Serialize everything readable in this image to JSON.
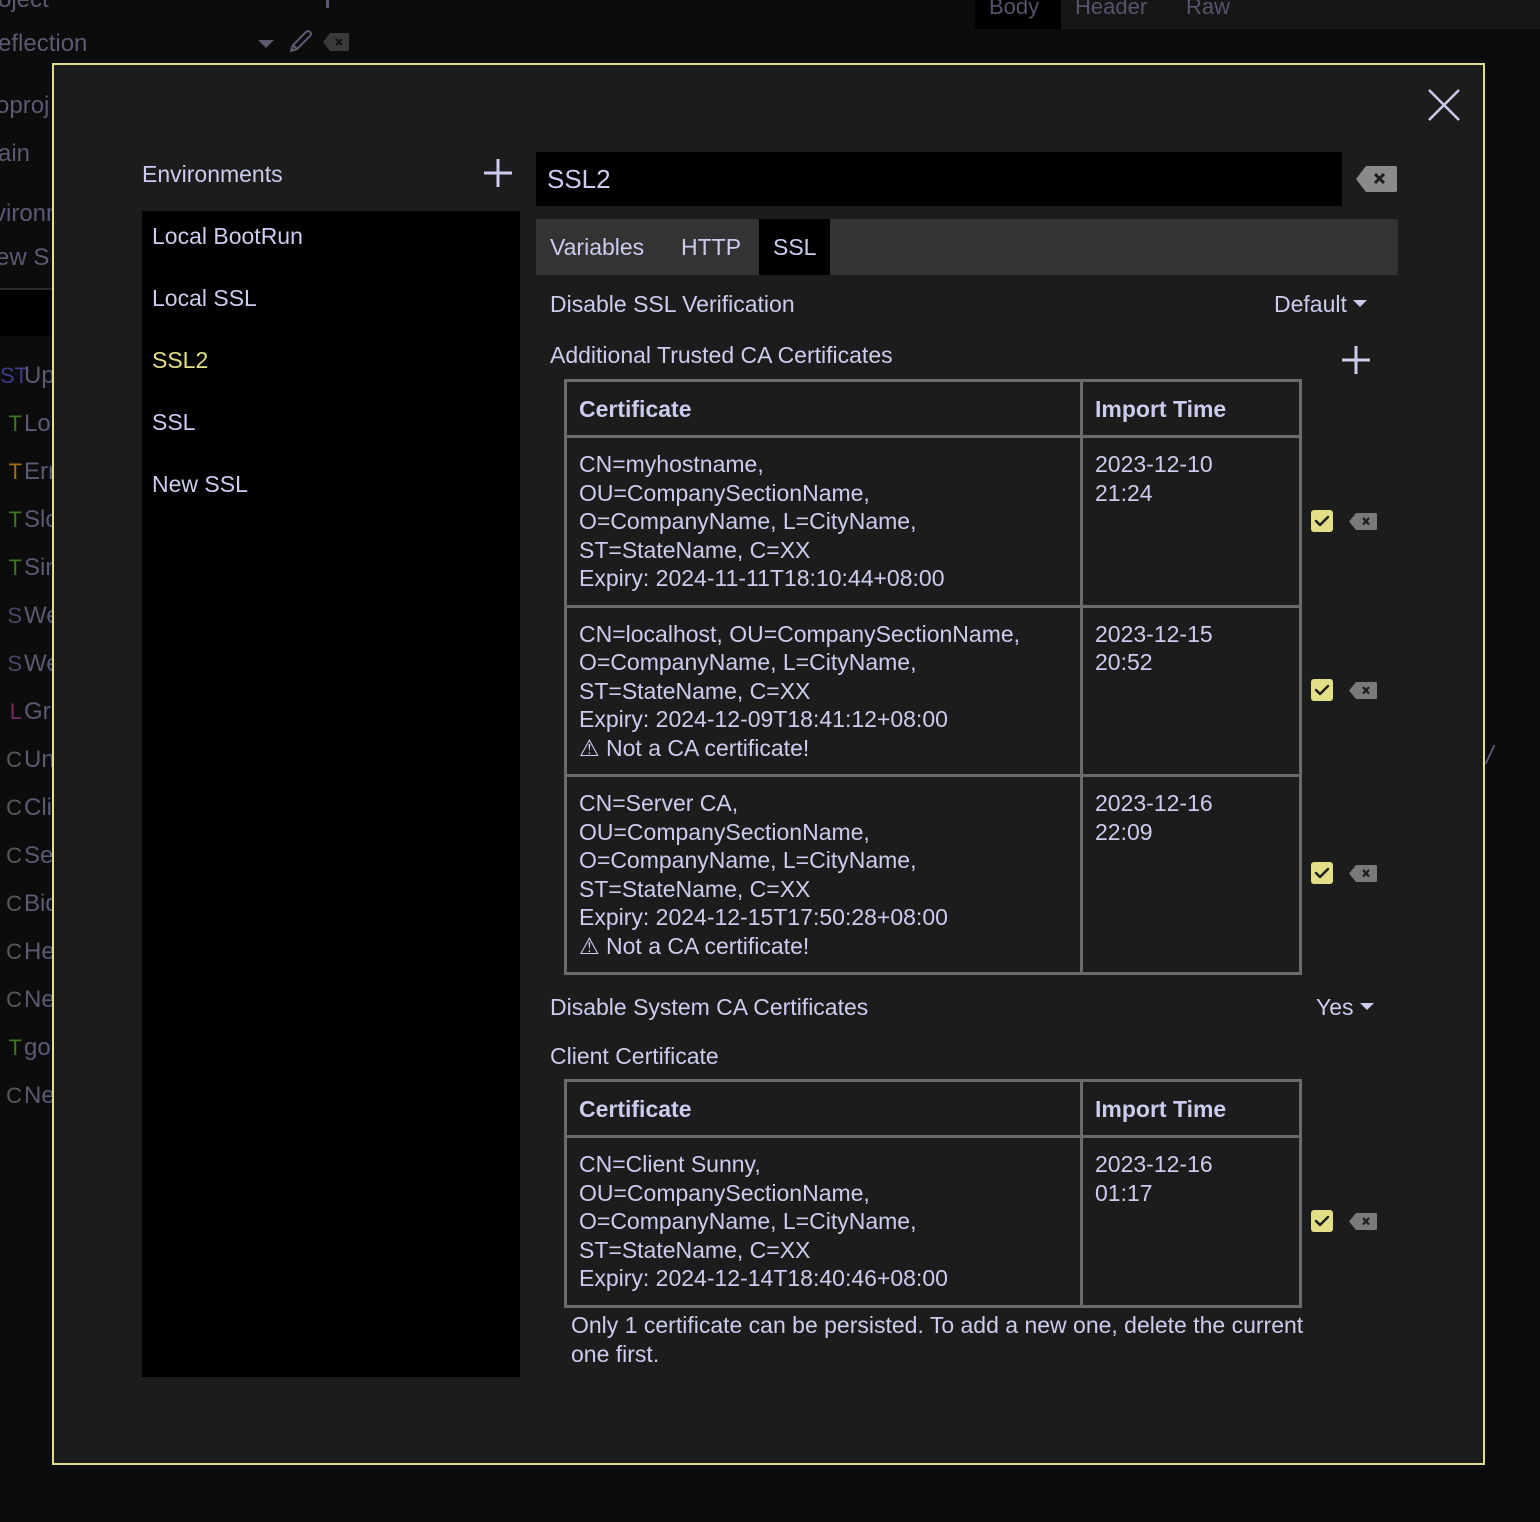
{
  "background": {
    "project_label_partial": "oject",
    "collection_partial": "eflection",
    "proj_partial": "oproj",
    "main_partial": "ain",
    "environment_partial": "vironm",
    "new_ssl_partial": "ew S",
    "requests": [
      {
        "method": "ST",
        "method_color": "#3d3a8a",
        "name": "Up"
      },
      {
        "method": "T",
        "method_color": "#3c7a1e",
        "name": "Lo"
      },
      {
        "method": "T",
        "method_color": "#a86a1a",
        "name": "Err"
      },
      {
        "method": "T",
        "method_color": "#3c7a1e",
        "name": "Slo"
      },
      {
        "method": "T",
        "method_color": "#3c7a1e",
        "name": "Sin"
      },
      {
        "method": "S",
        "method_color": "#4a4866",
        "name": "We"
      },
      {
        "method": "S",
        "method_color": "#4a4866",
        "name": "We"
      },
      {
        "method": "L",
        "method_color": "#7a2a5e",
        "name": "Gr"
      },
      {
        "method": "C",
        "method_color": "#5a5a5a",
        "name": "Un"
      },
      {
        "method": "C",
        "method_color": "#5a5a5a",
        "name": "Cli"
      },
      {
        "method": "C",
        "method_color": "#5a5a5a",
        "name": "Se"
      },
      {
        "method": "C",
        "method_color": "#5a5a5a",
        "name": "Bid"
      },
      {
        "method": "C",
        "method_color": "#5a5a5a",
        "name": "He"
      },
      {
        "method": "C",
        "method_color": "#5a5a5a",
        "name": "Ne"
      },
      {
        "method": "T",
        "method_color": "#3c7a1e",
        "name": "go"
      },
      {
        "method": "C",
        "method_color": "#5a5a5a",
        "name": "Ne"
      }
    ],
    "response_tabs": [
      "Body",
      "Header",
      "Raw"
    ],
    "active_response_tab": "Body"
  },
  "modal": {
    "accent_color": "#e3df86",
    "close_icon": "close-icon",
    "environments": {
      "title": "Environments",
      "add_icon": "plus-icon",
      "items": [
        {
          "label": "Local BootRun",
          "selected": false
        },
        {
          "label": "Local SSL",
          "selected": false
        },
        {
          "label": "SSL2",
          "selected": true
        },
        {
          "label": "SSL",
          "selected": false
        },
        {
          "label": "New SSL",
          "selected": false
        }
      ]
    },
    "editor": {
      "name_value": "SSL2",
      "delete_icon": "backspace-delete-icon",
      "tabs": [
        {
          "label": "Variables",
          "active": false
        },
        {
          "label": "HTTP",
          "active": false
        },
        {
          "label": "SSL",
          "active": true
        }
      ],
      "ssl": {
        "disable_verification_label": "Disable SSL Verification",
        "disable_verification_value": "Default",
        "trusted_ca_label": "Additional Trusted CA Certificates",
        "table_headers": {
          "certificate": "Certificate",
          "import_time": "Import Time"
        },
        "trusted_ca_certs": [
          {
            "lines": [
              "CN=myhostname,",
              "OU=CompanySectionName,",
              "O=CompanyName, L=CityName,",
              "ST=StateName, C=XX",
              "Expiry: 2024-11-11T18:10:44+08:00"
            ],
            "import_time": [
              "2023-12-10",
              "21:24"
            ],
            "enabled": true
          },
          {
            "lines": [
              "CN=localhost, OU=CompanySectionName,",
              "O=CompanyName, L=CityName,",
              "ST=StateName, C=XX",
              "Expiry: 2024-12-09T18:41:12+08:00",
              "⚠ Not a CA certificate!"
            ],
            "import_time": [
              "2023-12-15",
              "20:52"
            ],
            "enabled": true
          },
          {
            "lines": [
              "CN=Server CA,",
              "OU=CompanySectionName,",
              "O=CompanyName, L=CityName,",
              "ST=StateName, C=XX",
              "Expiry: 2024-12-15T17:50:28+08:00",
              "⚠ Not a CA certificate!"
            ],
            "import_time": [
              "2023-12-16",
              "22:09"
            ],
            "enabled": true
          }
        ],
        "disable_system_ca_label": "Disable System CA Certificates",
        "disable_system_ca_value": "Yes",
        "client_cert_label": "Client Certificate",
        "client_certs": [
          {
            "lines": [
              "CN=Client Sunny,",
              "OU=CompanySectionName,",
              "O=CompanyName, L=CityName,",
              "ST=StateName, C=XX",
              "Expiry: 2024-12-14T18:40:46+08:00"
            ],
            "import_time": [
              "2023-12-16",
              "01:17"
            ],
            "enabled": true
          }
        ],
        "client_cert_note": "Only 1 certificate can be persisted. To add a new one, delete the current one first."
      }
    }
  }
}
